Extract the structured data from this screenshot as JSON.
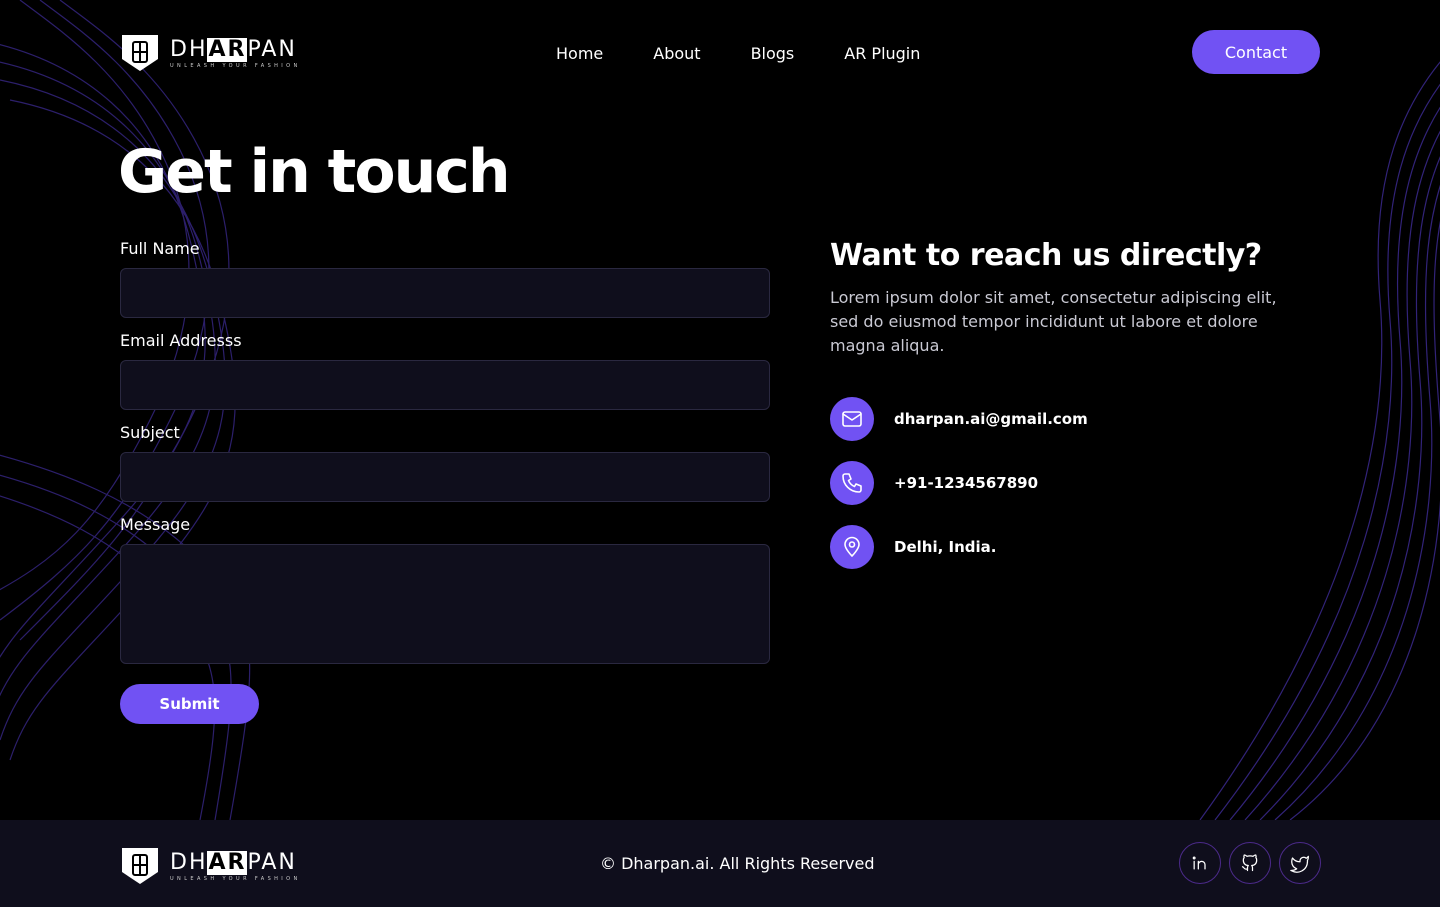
{
  "brand": {
    "name_pre": "DH",
    "name_ar": "AR",
    "name_post": "PAN",
    "tagline": "UNLEASH YOUR FASHION"
  },
  "nav": {
    "items": [
      {
        "label": "Home"
      },
      {
        "label": "About"
      },
      {
        "label": "Blogs"
      },
      {
        "label": "AR Plugin"
      }
    ],
    "contact_label": "Contact"
  },
  "page": {
    "title": "Get in touch"
  },
  "form": {
    "fields": [
      {
        "label": "Full Name",
        "value": ""
      },
      {
        "label": "Email Addresss",
        "value": ""
      },
      {
        "label": "Subject",
        "value": ""
      },
      {
        "label": "Message",
        "value": ""
      }
    ],
    "submit_label": "Submit"
  },
  "direct": {
    "title": "Want to reach us directly?",
    "description": "Lorem ipsum dolor sit amet, consectetur adipiscing elit, sed do eiusmod tempor incididunt ut labore et dolore magna aliqua.",
    "email": "dharpan.ai@gmail.com",
    "phone": "+91-1234567890",
    "location": "Delhi, India."
  },
  "footer": {
    "copyright": "© Dharpan.ai. All Rights Reserved",
    "socials": [
      "linkedin-icon",
      "github-icon",
      "twitter-icon"
    ]
  },
  "colors": {
    "accent": "#7152f3",
    "background": "#000000",
    "field_bg": "#0f0e1c",
    "footer_bg": "#0f0e1c"
  }
}
